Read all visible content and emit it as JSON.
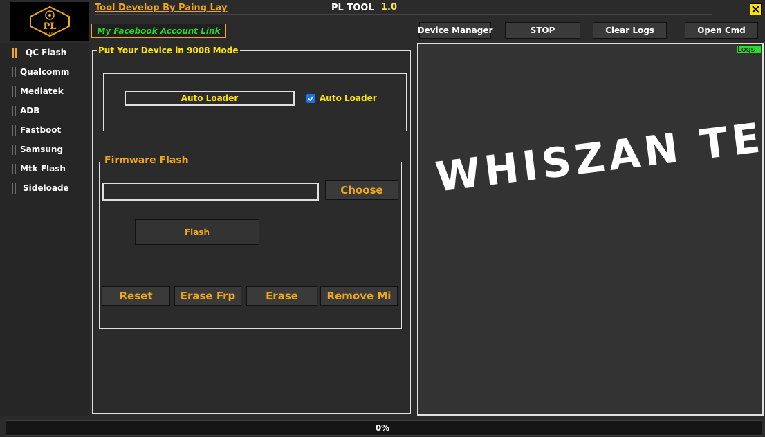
{
  "header": {
    "logo_text": "PL",
    "logo_subtext": "TOOL",
    "developer_link": "Tool Develop By Paing Lay",
    "app_name": "PL TOOL",
    "app_version": "1.0",
    "facebook_link": "My Facebook Account Link"
  },
  "toolbar": {
    "device_manager": "Device Manager",
    "stop": "STOP",
    "clear_logs": "Clear Logs",
    "open_cmd": "Open Cmd"
  },
  "sidebar": {
    "items": [
      {
        "label": "QC Flash",
        "active": true
      },
      {
        "label": "Qualcomm"
      },
      {
        "label": "Mediatek"
      },
      {
        "label": "ADB"
      },
      {
        "label": "Fastboot"
      },
      {
        "label": "Samsung"
      },
      {
        "label": "Mtk Flash"
      },
      {
        "label": "Sideloade"
      }
    ]
  },
  "qc_panel": {
    "title": "Put Your Device in 9008 Mode",
    "auto_loader_button": "Auto Loader",
    "auto_loader_checkbox": {
      "label": "Auto Loader",
      "checked": true
    },
    "firmware": {
      "title": "Firmware Flash",
      "path_value": "",
      "choose_button": "Choose",
      "flash_button": "Flash"
    },
    "actions": [
      "Reset",
      "Erase Frp",
      "Erase",
      "Remove Mi"
    ]
  },
  "logs": {
    "badge": "Logs",
    "watermark": "WHISZAN TECH"
  },
  "status": {
    "progress_text": "0%",
    "progress_value": 0
  },
  "colors": {
    "accent_orange": "#f0a818",
    "accent_yellow": "#ffe600",
    "accent_green": "#27e127",
    "panel_bg": "#2b2b2b"
  }
}
